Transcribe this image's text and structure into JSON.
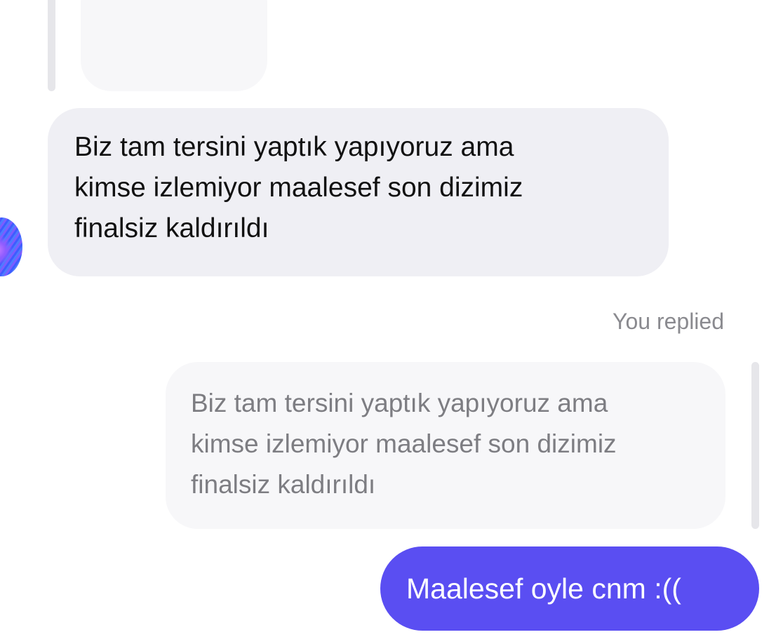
{
  "conversation": {
    "incoming_message": "Biz tam tersini yaptık yapıyoruz ama\nkimse izlemiyor maalesef son dizimiz\nfinalsiz kaldırıldı",
    "replied_label": "You replied",
    "quoted_message": "Biz tam tersini yaptık yapıyoruz ama\nkimse izlemiyor maalesef son dizimiz\nfinalsiz kaldırıldı",
    "outgoing_message": "Maalesef oyle cnm :(("
  },
  "colors": {
    "incoming_bubble": "#efeff4",
    "quoted_bubble": "#f7f7f9",
    "outgoing_bubble": "#5a4ef2",
    "quote_bar": "#e6e6ea",
    "secondary_text": "#8a8a8f"
  }
}
